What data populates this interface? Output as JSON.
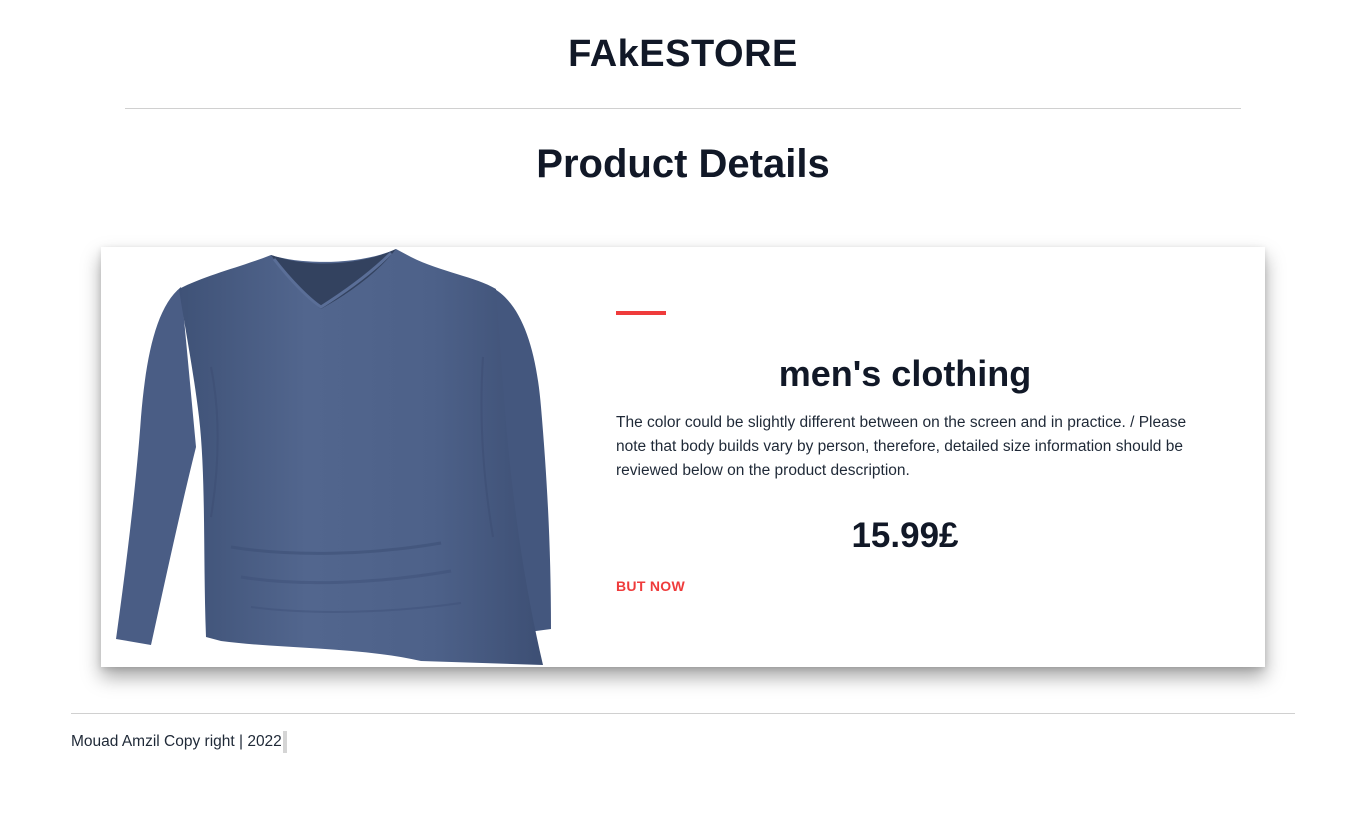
{
  "header": {
    "site_title": "FAkESTORE"
  },
  "main": {
    "page_heading": "Product Details",
    "product": {
      "category": "men's clothing",
      "description": "The color could be slightly different between on the screen and in practice. / Please note that body builds vary by person, therefore, detailed size information should be reviewed below on the product description.",
      "price": "15.99£",
      "buy_label": "BUT NOW",
      "image_icon": "long-sleeve-shirt-image",
      "shirt_color": "#4d6189"
    }
  },
  "footer": {
    "copyright": "Mouad Amzil Copy right | 2022"
  },
  "colors": {
    "accent": "#ef3b3b",
    "text": "#111827",
    "divider": "#d0d0d0"
  }
}
